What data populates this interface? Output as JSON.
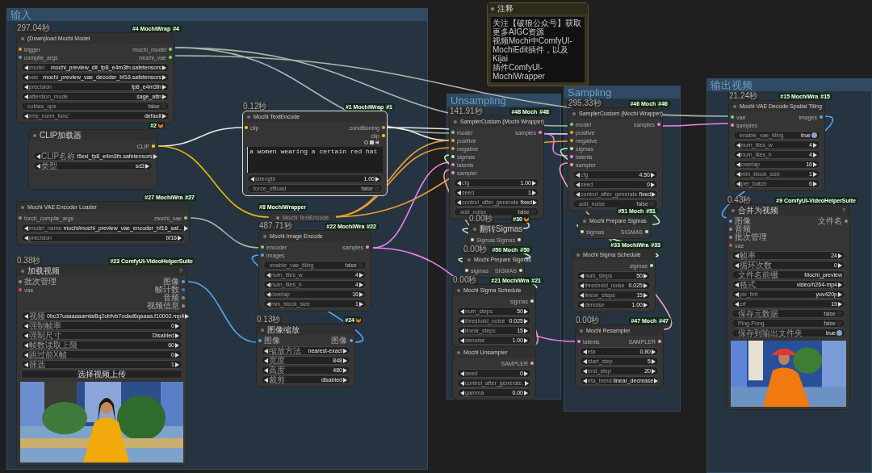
{
  "groups": [
    {
      "title": "输入"
    },
    {
      "title": "Unsampling"
    },
    {
      "title": "Sampling"
    },
    {
      "title": "输出视频"
    }
  ],
  "note": {
    "title": "注释",
    "lines": [
      "关注【破狼公众号】获取更多AIGC资源",
      "视频Mochi中ComfyUI-MochiEdit插件，以及Kijai",
      "插件ComfyUI-MochiWrapper"
    ]
  },
  "nodes": [
    {
      "kind": "full",
      "selected": false,
      "time": "297.04秒",
      "badge": {
        "kind": "pack",
        "text": "#4 MochiWrap",
        "id": "#4"
      },
      "title": "(Down)load Mochi Model",
      "inputs": [
        {
          "label": "trigger",
          "color": "#f0a030"
        },
        {
          "label": "compile_args",
          "color": "#8a8aa8"
        }
      ],
      "outputs": [
        {
          "label": "mochi_model",
          "color": "#6ee06e"
        },
        {
          "label": "mochi_vae",
          "color": "#6ee06e"
        }
      ],
      "widgets": [
        {
          "kind": "combo",
          "label": "model",
          "value": "mochi_preview_dit_fp8_e4m3fn.safetensors"
        },
        {
          "kind": "combo",
          "label": "vae",
          "value": "mochi_preview_vae_decoder_bf16.safetensors"
        },
        {
          "kind": "combo",
          "label": "precision",
          "value": "fp8_e4m3fn"
        },
        {
          "kind": "combo",
          "label": "attention_mode",
          "value": "sage_attn"
        },
        {
          "kind": "toggle",
          "label": "cublas_ops",
          "value": "false",
          "on": false
        },
        {
          "kind": "combo",
          "label": "rms_norm_func",
          "value": "default"
        }
      ]
    },
    {
      "kind": "full",
      "selected": false,
      "badge": {
        "kind": "core",
        "text": "#2"
      },
      "title": "CLIP加载器",
      "outputs": [
        {
          "label": "CLIP",
          "color": "#ffd000"
        }
      ],
      "widgets": [
        {
          "kind": "combo",
          "label": "CLIP名称",
          "value": "t5xxl_fp8_e4m3fn.safetensors"
        },
        {
          "kind": "combo",
          "label": "类型",
          "value": "sd3"
        }
      ]
    },
    {
      "kind": "full",
      "selected": false,
      "badge": {
        "kind": "pack",
        "text": "#27 MochiWra",
        "id": "#27"
      },
      "title": "Mochi VAE Encoder Loader",
      "inputs": [
        {
          "label": "torch_compile_args",
          "color": "#8a8aa8"
        }
      ],
      "outputs": [
        {
          "label": "mochi_vae",
          "color": "#6ee06e"
        }
      ],
      "widgets": [
        {
          "kind": "combo",
          "label": "model_name",
          "value": "mochi/mochi_preview_vae_encoder_bf16_saf..."
        },
        {
          "kind": "combo",
          "label": "precision",
          "value": "bf16"
        }
      ]
    },
    {
      "kind": "full",
      "selected": false,
      "time": "0.38秒",
      "badge": {
        "kind": "pack",
        "text": "#23 ComfyUI-VideoHelperSuite"
      },
      "title": "加载视频",
      "help": "?",
      "inputs": [
        {
          "label": "批次管理",
          "color": "#8a8aa8"
        },
        {
          "label": "vae",
          "color": "#e05050"
        }
      ],
      "outputs": [
        {
          "label": "图像",
          "color": "#50a8f0"
        },
        {
          "label": "帧计数",
          "color": "#3a78c8"
        },
        {
          "label": "音频",
          "color": "#8a8aa8"
        },
        {
          "label": "视频信息",
          "color": "#8a8aa8"
        }
      ],
      "widgets": [
        {
          "kind": "combo",
          "label": "视频",
          "value": "0bc37uaaaaaamtal8q2obfvb7odad6qaaaa.f10002.mp4"
        },
        {
          "kind": "combo",
          "label": "强制帧率",
          "value": "0"
        },
        {
          "kind": "combo",
          "label": "强制尺寸",
          "value": "Disabled"
        },
        {
          "kind": "combo",
          "label": "帧数读取上限",
          "value": "60"
        },
        {
          "kind": "combo",
          "label": "跳过前X帧",
          "value": "0"
        },
        {
          "kind": "combo",
          "label": "筛选",
          "value": "1"
        },
        {
          "kind": "button",
          "label": "选择视频上传"
        }
      ],
      "preview": {
        "kind": "picture"
      }
    },
    {
      "kind": "full",
      "selected": true,
      "time": "0.12秒",
      "badge": {
        "kind": "pack",
        "text": "#1 MochiWrap",
        "id": "#1"
      },
      "title": "Mochi TextEncode",
      "inputs": [
        {
          "label": "clip",
          "color": "#ffd000"
        }
      ],
      "outputs": [
        {
          "label": "conditioning",
          "color": "#f0a030"
        },
        {
          "label": "clip",
          "color": "#ffd000"
        }
      ],
      "prompt": "a women wearing a certain red hat",
      "widgets": [
        {
          "kind": "number",
          "label": "strength",
          "value": "1.00"
        },
        {
          "kind": "toggle",
          "label": "force_offload",
          "value": "false",
          "on": false
        }
      ]
    },
    {
      "kind": "collapsed",
      "selected": false,
      "badge": {
        "kind": "pack",
        "text": "#8 MochiWrapper"
      },
      "title": "Mochi TextEncode"
    },
    {
      "kind": "full",
      "selected": false,
      "time": "487.71秒",
      "badge": {
        "kind": "pack",
        "text": "#22 MochiWra",
        "id": "#22"
      },
      "title": "Mochi Image Encode",
      "inputs": [
        {
          "label": "encoder",
          "color": "#6ee06e"
        },
        {
          "label": "images",
          "color": "#50a8f0"
        }
      ],
      "outputs": [
        {
          "label": "samples",
          "color": "#f080f0"
        }
      ],
      "widgets": [
        {
          "kind": "toggle",
          "label": "enable_vae_tiling",
          "value": "false",
          "on": false
        },
        {
          "kind": "number",
          "label": "num_tiles_w",
          "value": "4"
        },
        {
          "kind": "number",
          "label": "num_tiles_h",
          "value": "4"
        },
        {
          "kind": "number",
          "label": "overlap",
          "value": "16"
        },
        {
          "kind": "number",
          "label": "min_block_size",
          "value": "1"
        }
      ]
    },
    {
      "kind": "full",
      "selected": false,
      "time": "0.13秒",
      "badge": {
        "kind": "core",
        "text": "#24"
      },
      "title": "图像缩放",
      "inputs": [
        {
          "label": "图像",
          "color": "#50a8f0"
        }
      ],
      "outputs": [
        {
          "label": "图像",
          "color": "#50a8f0"
        }
      ],
      "widgets": [
        {
          "kind": "combo",
          "label": "缩放方法",
          "value": "nearest-exact"
        },
        {
          "kind": "number",
          "label": "宽度",
          "value": "848"
        },
        {
          "kind": "number",
          "label": "高度",
          "value": "480"
        },
        {
          "kind": "combo",
          "label": "裁剪",
          "value": "disabled"
        }
      ]
    },
    {
      "kind": "full",
      "selected": false,
      "time": "141.91秒",
      "badge": {
        "kind": "pack",
        "text": "#48 Moch",
        "id": "#48"
      },
      "title": "SamplerCustom (Mochi Wrapper)",
      "inputs": [
        {
          "label": "model",
          "color": "#6ee06e"
        },
        {
          "label": "positive",
          "color": "#f0a030"
        },
        {
          "label": "negative",
          "color": "#f0a030"
        },
        {
          "label": "sigmas",
          "color": "#b8f0b0"
        },
        {
          "label": "latents",
          "color": "#f080f0"
        },
        {
          "label": "sampler",
          "color": "#f0a0a8"
        }
      ],
      "outputs": [
        {
          "label": "samples",
          "color": "#f080f0"
        }
      ],
      "widgets": [
        {
          "kind": "number",
          "label": "cfg",
          "value": "1.00"
        },
        {
          "kind": "number",
          "label": "seed",
          "value": "1"
        },
        {
          "kind": "combo",
          "label": "control_after_generate",
          "value": "fixed"
        },
        {
          "kind": "toggle",
          "label": "add_noise",
          "value": "false",
          "on": false
        }
      ]
    },
    {
      "kind": "full",
      "selected": false,
      "time": "0.00秒",
      "badge": {
        "kind": "core",
        "text": "#30"
      },
      "title": "翻转Sigmas",
      "inputs": [
        {
          "label": "Sigmas",
          "color": "#b8f0b0"
        }
      ],
      "outputs": [
        {
          "label": "Sigmas",
          "color": "#b8f0b0"
        }
      ]
    },
    {
      "kind": "full",
      "selected": false,
      "time": "0.00秒",
      "badge": {
        "kind": "pack",
        "text": "#50 Moch",
        "id": "#50"
      },
      "title": "Mochi Prepare Sigmas",
      "inputs": [
        {
          "label": "sigmas",
          "color": "#b8f0b0"
        }
      ],
      "outputs": [
        {
          "label": "SIGMAS",
          "color": "#b8f0b0"
        }
      ]
    },
    {
      "kind": "full",
      "selected": false,
      "time": "0.00秒",
      "badge": {
        "kind": "pack",
        "text": "#21 MochiWra",
        "id": "#21"
      },
      "title": "Mochi Sigma Schedule",
      "outputs": [
        {
          "label": "sigmas",
          "color": "#b8f0b0"
        }
      ],
      "widgets": [
        {
          "kind": "number",
          "label": "num_steps",
          "value": "50"
        },
        {
          "kind": "number",
          "label": "threshold_noise",
          "value": "0.025"
        },
        {
          "kind": "number",
          "label": "linear_steps",
          "value": "15"
        },
        {
          "kind": "number",
          "label": "denoise",
          "value": "1.00"
        }
      ]
    },
    {
      "kind": "full",
      "selected": false,
      "title": "Mochi Unsampler",
      "outputs": [
        {
          "label": "SAMPLER",
          "color": "#f0a0a8"
        }
      ],
      "widgets": [
        {
          "kind": "number",
          "label": "seed",
          "value": "0"
        },
        {
          "kind": "combo",
          "label": "control_after_generate."
        },
        {
          "kind": "number",
          "label": "gamma",
          "value": "0.00"
        }
      ]
    },
    {
      "kind": "full",
      "selected": false,
      "time": "295.33秒",
      "badge": {
        "kind": "pack",
        "text": "#46 Moch",
        "id": "#46"
      },
      "title": "SamplerCustom (Mochi Wrapper)",
      "inputs": [
        {
          "label": "model",
          "color": "#6ee06e"
        },
        {
          "label": "positive",
          "color": "#f0a030"
        },
        {
          "label": "negative",
          "color": "#f0a030"
        },
        {
          "label": "sigmas",
          "color": "#b8f0b0"
        },
        {
          "label": "latents",
          "color": "#f080f0"
        },
        {
          "label": "sampler",
          "color": "#f0a0a8"
        }
      ],
      "outputs": [
        {
          "label": "samples",
          "color": "#f080f0"
        }
      ],
      "widgets": [
        {
          "kind": "number",
          "label": "cfg",
          "value": "4.50"
        },
        {
          "kind": "number",
          "label": "seed",
          "value": "0"
        },
        {
          "kind": "combo",
          "label": "control_after_generate",
          "value": "fixed"
        },
        {
          "kind": "toggle",
          "label": "add_noise",
          "value": "false",
          "on": false
        }
      ]
    },
    {
      "kind": "full",
      "selected": false,
      "badge": {
        "kind": "pack",
        "text": "#51 Moch",
        "id": "#51"
      },
      "title": "Mochi Prepare Sigmas",
      "inputs": [
        {
          "label": "sigmas",
          "color": "#b8f0b0"
        }
      ],
      "outputs": [
        {
          "label": "SIGMAS",
          "color": "#b8f0b0"
        }
      ]
    },
    {
      "kind": "full",
      "selected": false,
      "badge": {
        "kind": "pack",
        "text": "#33 MochiWra",
        "id": "#33"
      },
      "title": "Mochi Sigma Schedule",
      "outputs": [
        {
          "label": "sigmas",
          "color": "#b8f0b0"
        }
      ],
      "widgets": [
        {
          "kind": "number",
          "label": "num_steps",
          "value": "50"
        },
        {
          "kind": "number",
          "label": "threshold_noise",
          "value": "0.025"
        },
        {
          "kind": "number",
          "label": "linear_steps",
          "value": "15"
        },
        {
          "kind": "number",
          "label": "denoise",
          "value": "1.00"
        }
      ]
    },
    {
      "kind": "full",
      "selected": false,
      "time": "0.00秒",
      "badge": {
        "kind": "pack",
        "text": "#47 Moch",
        "id": "#47"
      },
      "title": "Mochi Resampler",
      "inputs": [
        {
          "label": "latents",
          "color": "#f080f0"
        }
      ],
      "outputs": [
        {
          "label": "SAMPLER",
          "color": "#f0a0a8"
        }
      ],
      "widgets": [
        {
          "kind": "number",
          "label": "eta",
          "value": "0.80"
        },
        {
          "kind": "number",
          "label": "start_step",
          "value": "5"
        },
        {
          "kind": "number",
          "label": "end_step",
          "value": "20"
        },
        {
          "kind": "combo",
          "label": "eta_trend",
          "value": "linear_decrease"
        }
      ]
    },
    {
      "kind": "full",
      "selected": false,
      "time": "21.24秒",
      "badge": {
        "kind": "pack",
        "text": "#15 MochiWra",
        "id": "#15"
      },
      "title": "Mochi VAE Decode Spatial Tiling",
      "inputs": [
        {
          "label": "vae",
          "color": "#6ee06e"
        },
        {
          "label": "samples",
          "color": "#f080f0"
        }
      ],
      "outputs": [
        {
          "label": "images",
          "color": "#50a8f0"
        }
      ],
      "widgets": [
        {
          "kind": "toggle",
          "label": "enable_vae_tiling",
          "value": "true",
          "on": true
        },
        {
          "kind": "number",
          "label": "num_tiles_w",
          "value": "4"
        },
        {
          "kind": "number",
          "label": "num_tiles_h",
          "value": "4"
        },
        {
          "kind": "number",
          "label": "overlap",
          "value": "16"
        },
        {
          "kind": "number",
          "label": "min_block_size",
          "value": "1"
        },
        {
          "kind": "number",
          "label": "per_batch",
          "value": "6"
        }
      ]
    },
    {
      "kind": "full",
      "selected": false,
      "time": "0.43秒",
      "badge": {
        "kind": "pack",
        "text": "#9 ComfyUI-VideoHelperSuite"
      },
      "title": "合并为视频",
      "help": "?",
      "inputs": [
        {
          "label": "图像",
          "color": "#50a8f0"
        },
        {
          "label": "音频",
          "color": "#8a8aa8"
        },
        {
          "label": "批次管理",
          "color": "#8a8aa8"
        },
        {
          "label": "vae",
          "color": "#e05050"
        }
      ],
      "outputs": [
        {
          "label": "文件名",
          "color": "#8a8aa8"
        }
      ],
      "widgets": [
        {
          "kind": "number",
          "label": "帧率",
          "value": "24"
        },
        {
          "kind": "number",
          "label": "循环次数",
          "value": "0"
        },
        {
          "kind": "text",
          "label": "文件名前缀",
          "value": "Mochi_preview"
        },
        {
          "kind": "combo",
          "label": "格式",
          "value": "video/h264-mp4"
        },
        {
          "kind": "combo",
          "label": "pix_fmt",
          "value": "yuv420p"
        },
        {
          "kind": "number",
          "label": "crf",
          "value": "19"
        },
        {
          "kind": "toggle",
          "label": "保存元数据",
          "value": "false",
          "on": false
        },
        {
          "kind": "toggle",
          "label": "Ping-Pong",
          "value": "false",
          "on": false
        },
        {
          "kind": "toggle",
          "label": "保存到输出文件夹",
          "value": "true",
          "on": true
        }
      ],
      "preview": {
        "kind": "picture"
      }
    }
  ]
}
